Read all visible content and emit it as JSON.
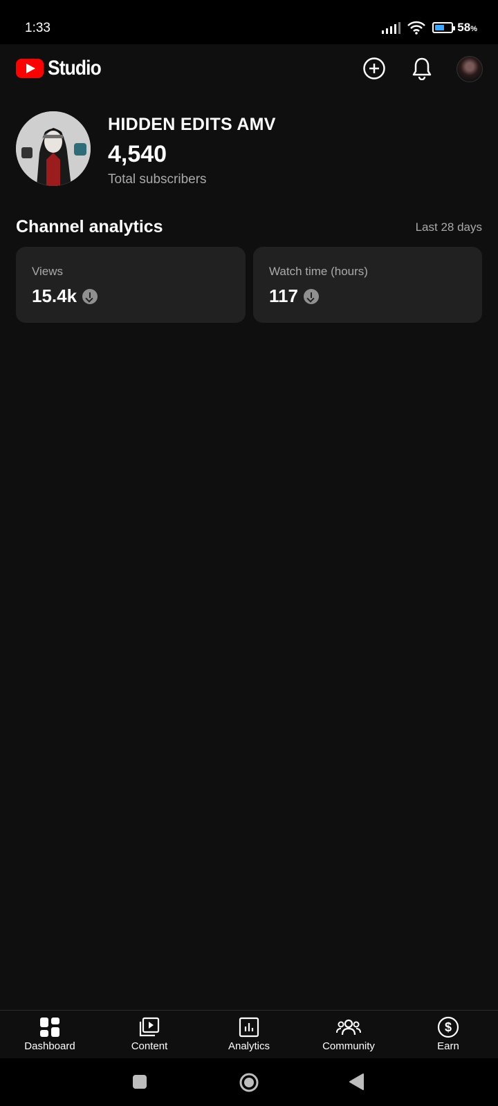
{
  "status_bar": {
    "time": "1:33",
    "battery_percent": "58",
    "battery_suffix": "%",
    "battery_level": 0.58
  },
  "header": {
    "logo_text": "Studio",
    "logo_icon": "youtube-logo",
    "icons": [
      "add-circle-icon",
      "bell-icon",
      "account-avatar"
    ]
  },
  "channel": {
    "name": "HIDDEN EDITS AMV",
    "subscribers": "4,540",
    "subscribers_label": "Total subscribers"
  },
  "analytics": {
    "title": "Channel analytics",
    "period": "Last 28 days",
    "cards": [
      {
        "label": "Views",
        "value": "15.4k",
        "trend": "down"
      },
      {
        "label": "Watch time (hours)",
        "value": "117",
        "trend": "down"
      }
    ]
  },
  "bottom_nav": {
    "items": [
      {
        "label": "Dashboard",
        "icon": "dashboard-icon",
        "active": true
      },
      {
        "label": "Content",
        "icon": "content-icon",
        "active": false
      },
      {
        "label": "Analytics",
        "icon": "analytics-icon",
        "active": false
      },
      {
        "label": "Community",
        "icon": "community-icon",
        "active": false
      },
      {
        "label": "Earn",
        "icon": "earn-icon",
        "active": false
      }
    ]
  },
  "colors": {
    "background": "#0f0f0f",
    "card": "#212121",
    "brand_red": "#ff0000",
    "secondary_text": "#aaaaaa"
  }
}
